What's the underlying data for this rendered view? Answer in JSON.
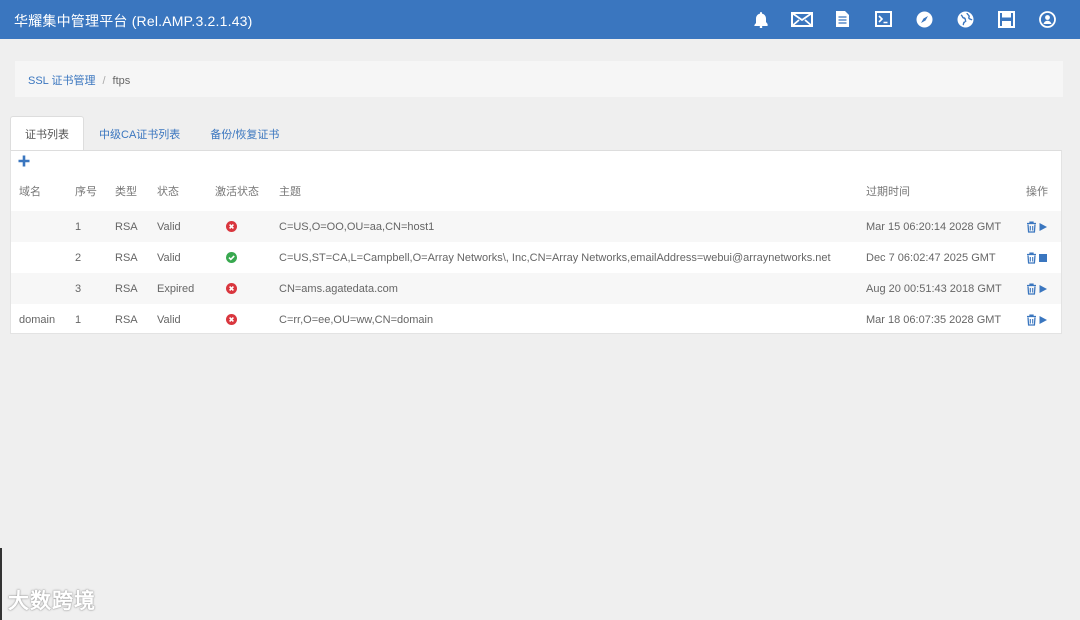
{
  "app": {
    "title": "华耀集中管理平台 (Rel.AMP.3.2.1.43)",
    "header_color": "#3a76bf",
    "toolbar_icons": [
      "bell-icon",
      "mail-icon",
      "document-icon",
      "terminal-icon",
      "compass-icon",
      "globe-icon",
      "save-icon",
      "user-icon"
    ]
  },
  "breadcrumb": {
    "link": "SSL 证书管理",
    "separator": "/",
    "current": "ftps"
  },
  "tabs": [
    {
      "label": "证书列表",
      "active": true
    },
    {
      "label": "中级CA证书列表",
      "active": false
    },
    {
      "label": "备份/恢复证书",
      "active": false
    }
  ],
  "add_button_icon": "plus-icon",
  "table": {
    "headers": {
      "domain": "域名",
      "seq": "序号",
      "type": "类型",
      "status": "状态",
      "active": "激活状态",
      "subject": "主题",
      "expire": "过期时间",
      "ops": "操作"
    },
    "rows": [
      {
        "domain": "",
        "seq": "1",
        "type": "RSA",
        "status": "Valid",
        "activated": false,
        "subject": "C=US,O=OO,OU=aa,CN=host1",
        "expire": "Mar 15 06:20:14 2028 GMT",
        "op_icon": "play-icon"
      },
      {
        "domain": "",
        "seq": "2",
        "type": "RSA",
        "status": "Valid",
        "activated": true,
        "subject": "C=US,ST=CA,L=Campbell,O=Array Networks\\, Inc,CN=Array Networks,emailAddress=webui@arraynetworks.net",
        "expire": "Dec 7 06:02:47 2025 GMT",
        "op_icon": "stop-icon"
      },
      {
        "domain": "",
        "seq": "3",
        "type": "RSA",
        "status": "Expired",
        "activated": false,
        "subject": "CN=ams.agatedata.com",
        "expire": "Aug 20 00:51:43 2018 GMT",
        "op_icon": "play-icon"
      },
      {
        "domain": "domain",
        "seq": "1",
        "type": "RSA",
        "status": "Valid",
        "activated": false,
        "subject": "C=rr,O=ee,OU=ww,CN=domain",
        "expire": "Mar 18 06:07:35 2028 GMT",
        "op_icon": "play-icon"
      }
    ]
  },
  "watermark": "大数跨境"
}
